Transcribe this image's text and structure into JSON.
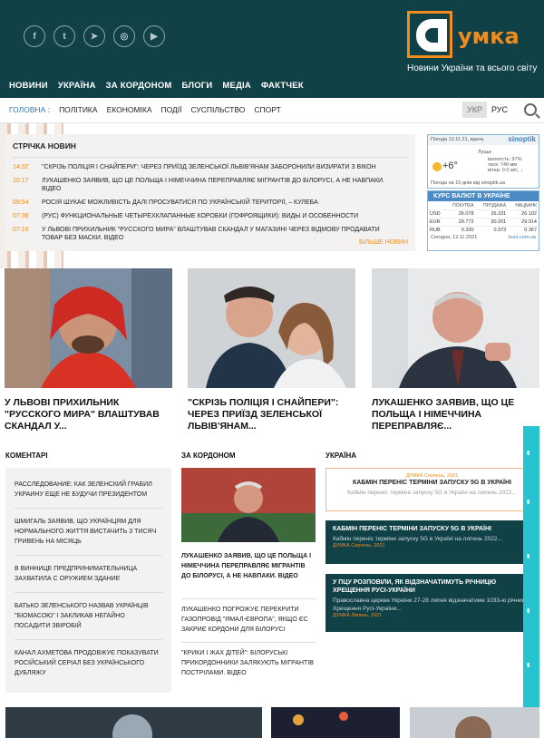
{
  "site": {
    "logo_text": "умка",
    "tagline": "Новини України та всього світу",
    "social_icons": [
      "facebook-icon",
      "twitter-icon",
      "telegram-icon",
      "instagram-icon",
      "youtube-icon"
    ]
  },
  "main_nav": [
    "НОВИНИ",
    "УКРАЇНА",
    "ЗА КОРДОНОМ",
    "БЛОГИ",
    "МЕДІА",
    "ФАКТЧЕК"
  ],
  "breadcrumb": {
    "home": "ГОЛОВНА",
    "separator": ":"
  },
  "sub_nav": [
    "ПОЛІТИКА",
    "ЕКОНОМІКА",
    "ПОДІЇ",
    "СУСПІЛЬСТВО",
    "СПОРТ"
  ],
  "lang": {
    "ukr": "УКР",
    "rus": "РУС"
  },
  "ticker": {
    "title": "СТРІЧКА НОВИН",
    "more": "БІЛЬШЕ НОВИН",
    "items": [
      {
        "time": "14:32",
        "text": "\"СКРІЗЬ ПОЛІЦІЯ І СНАЙПЕРИ\": ЧЕРЕЗ ПРИЇЗД ЗЕЛЕНСЬКОЇ ЛЬВІВ'ЯНАМ ЗАБОРОНИЛИ ВИЗИРАТИ З ВІКОН"
      },
      {
        "time": "10:17",
        "text": "ЛУКАШЕНКО ЗАЯВИВ, ЩО ЦЕ ПОЛЬЩА І НІМЕЧЧИНА ПЕРЕПРАВЛЯЄ МІГРАНТІВ ДО БІЛОРУСІ, А НЕ НАВПАКИ. ВІДЕО"
      },
      {
        "time": "09:54",
        "text": "РОСІЯ ШУКАЄ МОЖЛИВІСТЬ ДАЛІ ПРОСУВАТИСЯ ПО УКРАЇНСЬКІЙ ТЕРИТОРІЇ, – КУЛЕБА"
      },
      {
        "time": "07:38",
        "text": "(РУС) ФУНКЦИОНАЛЬНЫЕ ЧЕТЫРЕХКЛАПАННЫЕ КОРОБКИ (ГОФРОЯЩИКИ): ВИДЫ И ОСОБЕННОСТИ"
      },
      {
        "time": "07:10",
        "text": "У ЛЬВОВІ ПРИХИЛЬНИК \"РУССКОГО МИРА\" ВЛАШТУВАВ СКАНДАЛ У МАГАЗИНІ ЧЕРЕЗ ВІДМОВУ ПРОДАВАТИ ТОВАР БЕЗ МАСКИ. ВІДЕО"
      }
    ]
  },
  "weather": {
    "header": "Погода 12.11.21, вдень",
    "brand": "sinoptik",
    "temp": "+6°",
    "city": "Луцьк",
    "details": [
      "вологість: 97%",
      "тиск: 749 мм",
      "вітер: 0.0 м/с, ↓"
    ],
    "footer": "Погода на 10 днів від sinoptik.ua"
  },
  "rates": {
    "title": "КУРС ВАЛЮТ В УКРАЇНЕ",
    "headers": [
      "",
      "ПОКУПКА",
      "ПРОДАЖА",
      "НАЦБАНК"
    ],
    "rows": [
      [
        "USD",
        "26.078",
        "26.331",
        "26.102"
      ],
      [
        "EUR",
        "29.772",
        "30.201",
        "29.914"
      ],
      [
        "RUB",
        "0.330",
        "0.373",
        "0.367"
      ]
    ],
    "date": "Сегодня, 12.11.2021",
    "source": "kurs.com.ua"
  },
  "featured": [
    "У ЛЬВОВІ ПРИХИЛЬНИК \"РУССКОГО МИРА\" ВЛАШТУВАВ СКАНДАЛ У...",
    "\"СКРІЗЬ ПОЛІЦІЯ І СНАЙПЕРИ\": ЧЕРЕЗ ПРИЇЗД ЗЕЛЕНСЬКОЇ ЛЬВІВ'ЯНАМ...",
    "ЛУКАШЕНКО ЗАЯВИВ, ЩО ЦЕ ПОЛЬЩА І НІМЕЧЧИНА ПЕРЕПРАВЛЯЄ..."
  ],
  "sections": {
    "comments": "КОМЕНТАРІ",
    "abroad": "ЗА КОРДОНОМ",
    "ukraine": "УКРАЇНА"
  },
  "comments": [
    "РАССЛЕДОВАНИЕ: КАК ЗЕЛЕНСКИЙ ГРАБИЛ УКРАИНУ ЕЩЕ НЕ БУДУЧИ ПРЕЗИДЕНТОМ",
    "ШМИГАЛЬ ЗАЯВИВ, ЩО УКРАЇНЦЯМ ДЛЯ НОРМАЛЬНОГО ЖИТТЯ ВИСТАЧИТЬ 3 ТИСЯЧ ГРИВЕНЬ НА МІСЯЦЬ",
    "В ВИННИЦЕ ПРЕДПРИНИМАТЕЛЬНИЦА ЗАХВАТИЛА С ОРУЖИЕМ ЗДАНИЕ",
    "БАТЬКО ЗЕЛЕНСЬКОГО НАЗВАВ УКРАЇНЦІВ \"БІОМАСОЮ\" І ЗАКЛИКАВ НЕГАЙНО ПОСАДИТИ ЗВІРОБІЙ",
    "КАНАЛ АХМЕТОВА ПРОДОВЖУЄ ПОКАЗУВАТИ РОСІЙСЬКИЙ СЕРІАЛ БЕЗ УКРАЇНСЬКОГО ДУБЛЯЖУ"
  ],
  "abroad": [
    "ЛУКАШЕНКО ЗАЯВИВ, ЩО ЦЕ ПОЛЬЩА І НІМЕЧЧИНА ПЕРЕПРАВЛЯЄ МІГРАНТІВ ДО БІЛОРУСІ, А НЕ НАВПАКИ. ВІДЕО",
    "ЛУКАШЕНКО ПОГРОЖУЄ ПЕРЕКРИТИ ГАЗОПРОВІД \"ЯМАЛ-ЄВРОПА\", ЯКЩО ЄС ЗАКРИЄ КОРДОНИ ДЛЯ БІЛОРУСІ",
    "\"КРИКИ І ЖАХ ДІТЕЙ\": БІЛОРУСЬКІ ПРИКОРДОННИКИ ЗАЛЯКУЮТЬ МІГРАНТІВ ПОСТРІЛАМИ. ВІДЕО"
  ],
  "ukraine": [
    {
      "meta": "ДУМКА Серпень, 2021",
      "title": "КАБМІН ПЕРЕНІС ТЕРМІНИ ЗАПУСКУ 5G В УКРАЇНІ",
      "sub": "Кабмін переніс терміни запуску 5G в Україні на липень 2022..."
    },
    {
      "meta": "ДУМКА Серпень, 2021",
      "title": "КАБМІН ПЕРЕНІС ТЕРМІНИ ЗАПУСКУ 5G В УКРАЇНІ",
      "sub": "Кабмін переніс терміни запуску 5G в Україні на липень 2022..."
    },
    {
      "meta": "ДУМКА Липень, 2021",
      "title": "У ПЦУ РОЗПОВІЛИ, ЯК ВІДЗНАЧАТИМУТЬ РІЧНИЦЮ ХРЕЩЕННЯ РУСІ-УКРАЇНИ",
      "sub": "Православна церква України 27-28 липня відзначатиме 1033-ю річницю Хрещення Русі-України..."
    }
  ]
}
